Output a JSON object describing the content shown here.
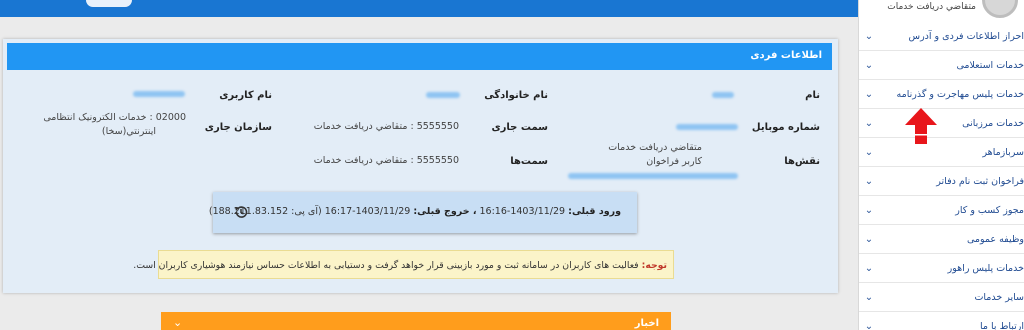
{
  "header": {
    "card_title": "اطلاعات فردی"
  },
  "sidebar": {
    "user_role": "متقاضي دريافت خدمات",
    "items": [
      "احراز اطلاعات فردی و آدرس",
      "خدمات استعلامی",
      "خدمات پلیس مهاجرت و گذرنامه",
      "خدمات مرزبانی",
      "سربازماهر",
      "فراخوان ثبت نام دفاتر",
      "مجوز کسب و کار",
      "وظیفه عمومی",
      "خدمات پلیس راهور",
      "سایر خدمات",
      "ارتباط با ما"
    ]
  },
  "profile": {
    "labels": {
      "name": "نام",
      "family": "نام خانوادگی",
      "username": "نام کاربری",
      "mobile": "شماره موبایل",
      "current_position": "سمت جاری",
      "current_org": "سازمان جاری",
      "roles": "نقش‌ها",
      "positions": "سمت‌ها"
    },
    "values": {
      "current_position": "5555550 : متقاضي دريافت خدمات",
      "current_org_line1": "02000 : خدمات الکترونیک انتظامی",
      "current_org_line2": "اینترنتي(سخا)",
      "roles_line1": "متقاضي دريافت خدمات",
      "roles_line2": "کاربر فراخوان",
      "positions": "5555550 : متقاضي دريافت خدمات"
    }
  },
  "login": {
    "label": "ورود قبلی:",
    "prev_login": "1403/11/29-16:16",
    "logout_label": "، خروج قبلی:",
    "prev_logout": "1403/11/29-16:17",
    "ip": "(آی پی: 188.211.83.152)"
  },
  "notice": {
    "label": "توجه:",
    "text": "فعالیت های کاربران در سامانه ثبت و مورد بازبینی قرار خواهد گرفت و دستیابی به اطلاعات حساس نیازمند هوشیاری کاربران است."
  },
  "news": {
    "title": "اخبار"
  },
  "colors": {
    "primary": "#2196f3",
    "topbar": "#1976d2",
    "accent_orange": "#ff9d1c",
    "arrow_red": "#e8161b"
  }
}
